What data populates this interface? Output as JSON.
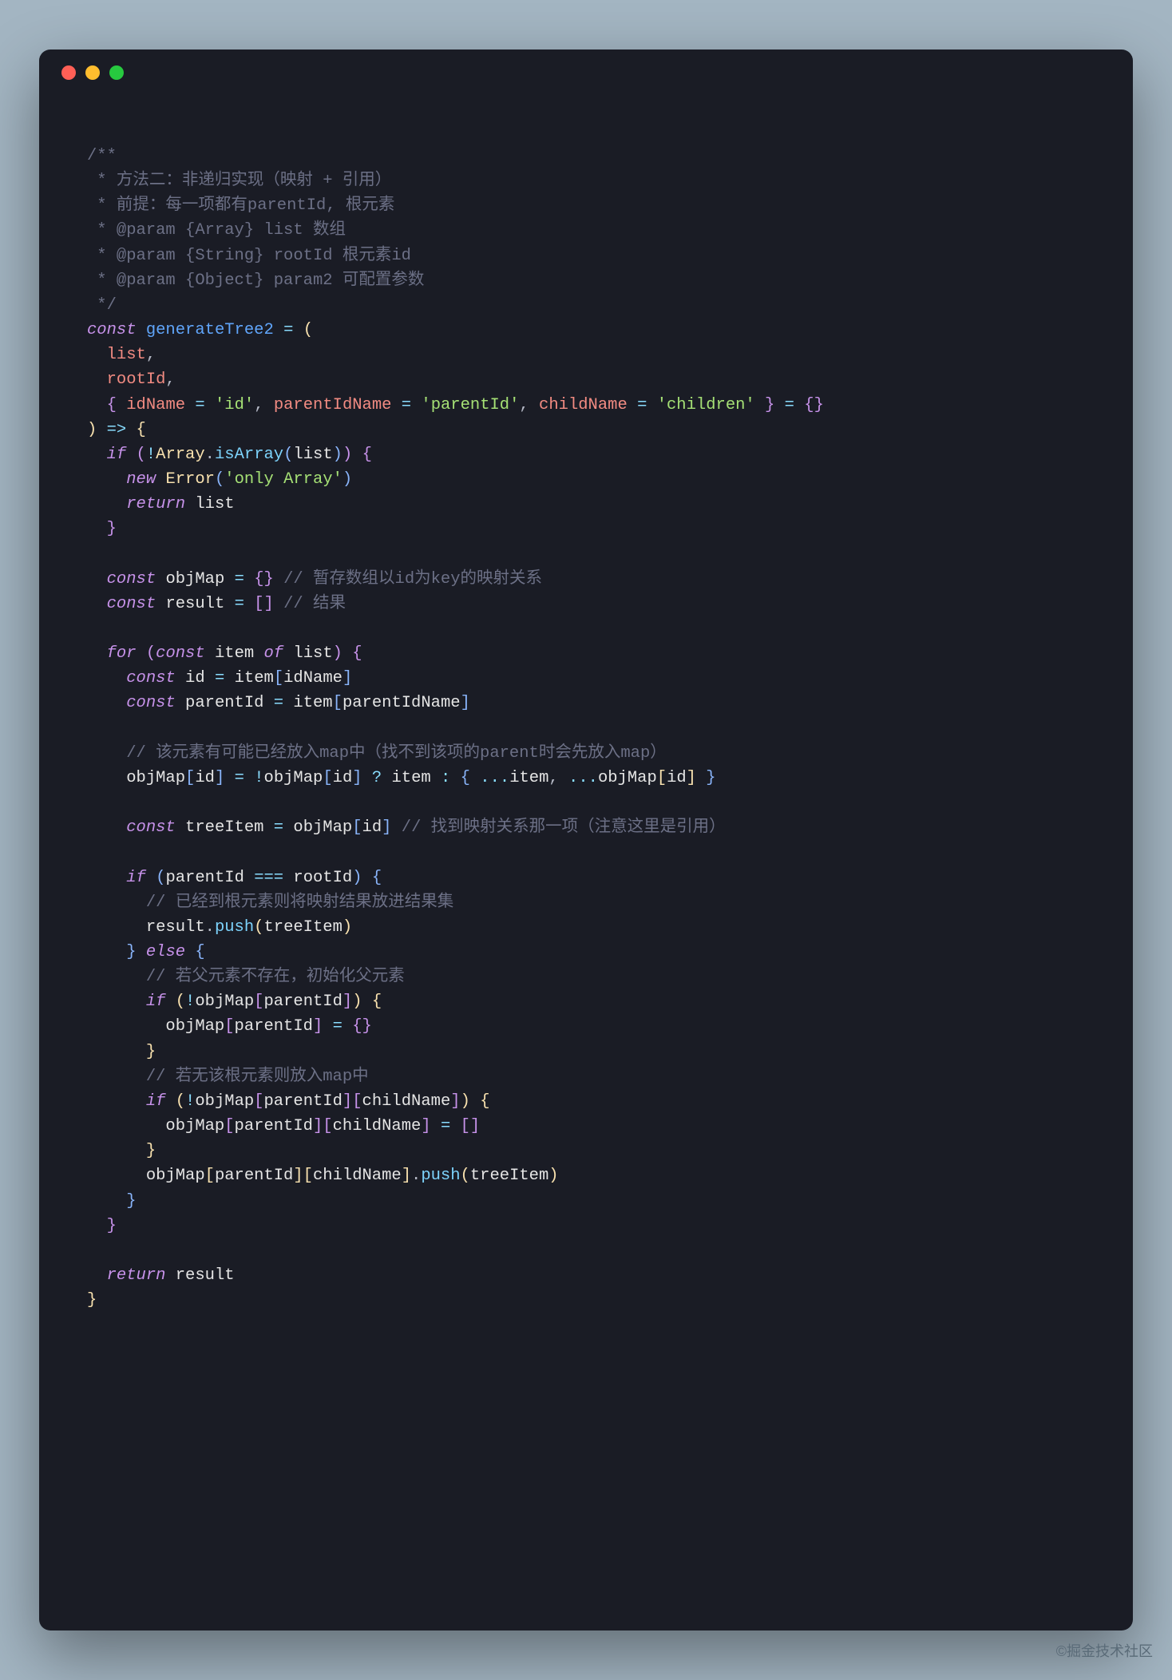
{
  "watermark": "©掘金技术社区",
  "code": {
    "comments": {
      "l1": "/**",
      "l2": " * 方法二：非递归实现（映射 + 引用）",
      "l3": " * 前提：每一项都有parentId, 根元素",
      "l4": " * @param {Array} list 数组",
      "l5": " * @param {String} rootId 根元素id",
      "l6": " * @param {Object} param2 可配置参数",
      "l7": " */",
      "c_objMap": "// 暂存数组以id为key的映射关系",
      "c_result": "// 结果",
      "c_maybe": "// 该元素有可能已经放入map中（找不到该项的parent时会先放入map）",
      "c_treeItem": "// 找到映射关系那一项（注意这里是引用）",
      "c_root": "// 已经到根元素则将映射结果放进结果集",
      "c_noParent": "// 若父元素不存在，初始化父元素",
      "c_noChild": "// 若无该根元素则放入map中"
    },
    "kw": {
      "const": "const",
      "if": "if",
      "else": "else",
      "for": "for",
      "of": "of",
      "new": "new",
      "return": "return"
    },
    "fn": {
      "generateTree2": "generateTree2",
      "isArray": "isArray",
      "push": "push"
    },
    "class": {
      "Array": "Array",
      "Error": "Error"
    },
    "ident": {
      "list": "list",
      "rootId": "rootId",
      "idName": "idName",
      "parentIdName": "parentIdName",
      "childName": "childName",
      "objMap": "objMap",
      "result": "result",
      "item": "item",
      "id": "id",
      "parentId": "parentId",
      "treeItem": "treeItem"
    },
    "str": {
      "id": "'id'",
      "parentId": "'parentId'",
      "children": "'children'",
      "onlyArray": "'only Array'"
    },
    "op": {
      "assign": "=",
      "arrow": "=>",
      "not": "!",
      "tern_q": "?",
      "tern_c": ":",
      "eq3": "===",
      "spread": "..."
    },
    "punct": {
      "lparen": "(",
      "rparen": ")",
      "lbrack": "[",
      "rbrack": "]",
      "comma": ",",
      "dot": "."
    }
  }
}
